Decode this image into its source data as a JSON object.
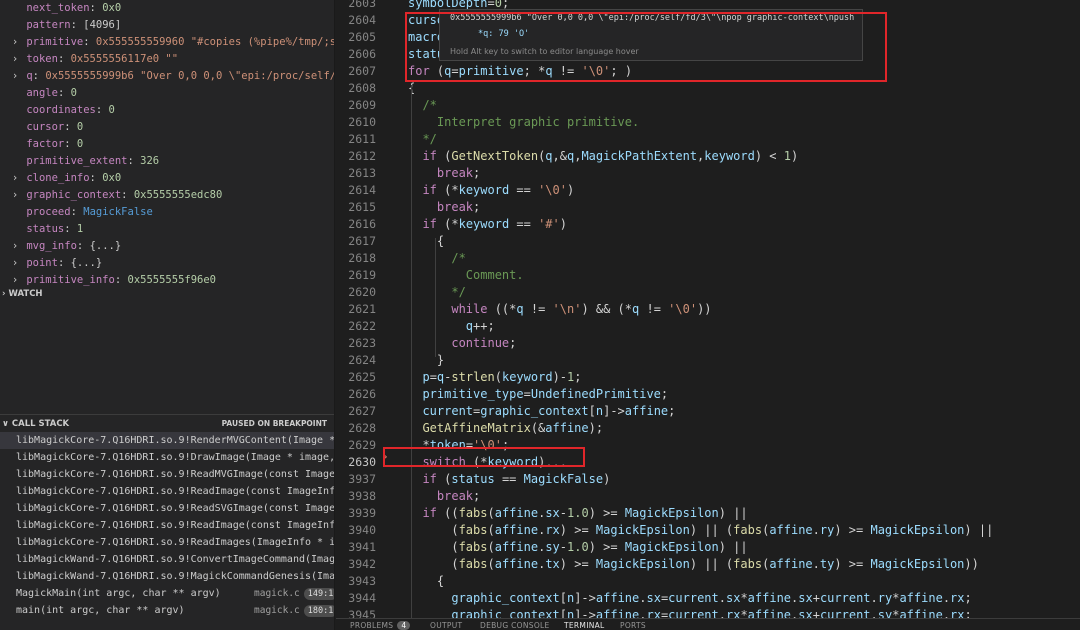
{
  "variables": [
    {
      "twisty": "",
      "name": "next_token",
      "value": "0x0",
      "vtype": "n"
    },
    {
      "twisty": "",
      "name": "pattern",
      "value": "[4096]",
      "vtype": "p"
    },
    {
      "twisty": "›",
      "name": "primitive",
      "value": "0x555555559960 \"#copies (%pipe%/tmp/;sleep 10…",
      "vtype": "v"
    },
    {
      "twisty": "›",
      "name": "token",
      "value": "0x5555556117e0 \"\"",
      "vtype": "v"
    },
    {
      "twisty": "›",
      "name": "q",
      "value": "0x5555555999b6 \"Over 0,0 0,0 \\\"epi:/proc/self/fd/3\\\"\\…",
      "vtype": "v"
    },
    {
      "twisty": "",
      "name": "angle",
      "value": "0",
      "vtype": "n"
    },
    {
      "twisty": "",
      "name": "coordinates",
      "value": "0",
      "vtype": "n"
    },
    {
      "twisty": "",
      "name": "cursor",
      "value": "0",
      "vtype": "n"
    },
    {
      "twisty": "",
      "name": "factor",
      "value": "0",
      "vtype": "n"
    },
    {
      "twisty": "",
      "name": "primitive_extent",
      "value": "326",
      "vtype": "n"
    },
    {
      "twisty": "›",
      "name": "clone_info",
      "value": "0x0",
      "vtype": "n"
    },
    {
      "twisty": "›",
      "name": "graphic_context",
      "value": "0x5555555edc80",
      "vtype": "n"
    },
    {
      "twisty": "",
      "name": "proceed",
      "value": "MagickFalse",
      "vtype": "b"
    },
    {
      "twisty": "",
      "name": "status",
      "value": "1",
      "vtype": "n"
    },
    {
      "twisty": "›",
      "name": "mvg_info",
      "value": "{...}",
      "vtype": "p"
    },
    {
      "twisty": "›",
      "name": "point",
      "value": "{...}",
      "vtype": "p"
    },
    {
      "twisty": "›",
      "name": "primitive_info",
      "value": "0x5555555f96e0",
      "vtype": "n"
    }
  ],
  "watch": {
    "label": "WATCH",
    "twisty": "›"
  },
  "callstack": {
    "label": "CALL STACK",
    "twisty": "∨",
    "status": "PAUSED ON BREAKPOINT",
    "frames": [
      {
        "name": "libMagickCore-7.Q16HDRI.so.9!RenderMVGContent(Image * image, const DrawInfo * draw_info, const size_t depth)",
        "src": "",
        "line": "",
        "active": true
      },
      {
        "name": "libMagickCore-7.Q16HDRI.so.9!DrawImage(Image * image, const DrawInfo * draw_info)",
        "src": "",
        "line": ""
      },
      {
        "name": "libMagickCore-7.Q16HDRI.so.9!ReadMVGImage(const ImageInfo * image_info)",
        "src": "",
        "line": ""
      },
      {
        "name": "libMagickCore-7.Q16HDRI.so.9!ReadImage(const ImageInfo * image_info)",
        "src": "",
        "line": ""
      },
      {
        "name": "libMagickCore-7.Q16HDRI.so.9!ReadSVGImage(const ImageInfo * image_info)",
        "src": "",
        "line": ""
      },
      {
        "name": "libMagickCore-7.Q16HDRI.so.9!ReadImage(const ImageInfo * image_info)",
        "src": "",
        "line": ""
      },
      {
        "name": "libMagickCore-7.Q16HDRI.so.9!ReadImages(ImageInfo * image_info)",
        "src": "",
        "line": ""
      },
      {
        "name": "libMagickWand-7.Q16HDRI.so.9!ConvertImageCommand(ImageInfo * image_info)",
        "src": "",
        "line": ""
      },
      {
        "name": "libMagickWand-7.Q16HDRI.so.9!MagickCommandGenesis(ImageInfo * image_info)",
        "src": "",
        "line": ""
      },
      {
        "name": "MagickMain(int argc, char ** argv)",
        "src": "magick.c",
        "line": "149:1"
      },
      {
        "name": "main(int argc, char ** argv)",
        "src": "magick.c",
        "line": "180:1"
      }
    ]
  },
  "hover": {
    "line1": "0x5555555999b6 \"Over 0,0 0,0 \\\"epi:/proc/self/fd/3\\\"\\npop graphic-context\\npush graphic-contex…",
    "line2": "*q: 79 'O'",
    "line3": "Hold Alt key to switch to editor language hover"
  },
  "code": [
    {
      "n": "2603",
      "html": "<span class=\"vr\">symbolDepth</span>=<span class=\"nm\">0</span>;"
    },
    {
      "n": "2604",
      "html": "<span class=\"vr\">curso</span>"
    },
    {
      "n": "2605",
      "html": "<span class=\"vr\">macro</span>"
    },
    {
      "n": "2606",
      "html": "<span class=\"vr\">statu</span>"
    },
    {
      "n": "2607",
      "html": "<span class=\"kw\">for</span> (<span class=\"vr\">q</span>=<span class=\"vr\">primitive</span>; *<span class=\"vr\">q</span> != <span class=\"st\">'\\0'</span>; )"
    },
    {
      "n": "2608",
      "html": "{"
    },
    {
      "n": "2609",
      "html": "  <span class=\"cm\">/*</span>"
    },
    {
      "n": "2610",
      "html": "  <span class=\"cm\">  Interpret graphic primitive.</span>"
    },
    {
      "n": "2611",
      "html": "  <span class=\"cm\">*/</span>"
    },
    {
      "n": "2612",
      "html": "  <span class=\"kw\">if</span> (<span class=\"fn\">GetNextToken</span>(<span class=\"vr\">q</span>,&amp;<span class=\"vr\">q</span>,<span class=\"vr\">MagickPathExtent</span>,<span class=\"vr\">keyword</span>) &lt; <span class=\"nm\">1</span>)"
    },
    {
      "n": "2613",
      "html": "    <span class=\"kw\">break</span>;"
    },
    {
      "n": "2614",
      "html": "  <span class=\"kw\">if</span> (*<span class=\"vr\">keyword</span> == <span class=\"st\">'\\0'</span>)"
    },
    {
      "n": "2615",
      "html": "    <span class=\"kw\">break</span>;"
    },
    {
      "n": "2616",
      "html": "  <span class=\"kw\">if</span> (*<span class=\"vr\">keyword</span> == <span class=\"st\">'#'</span>)"
    },
    {
      "n": "2617",
      "html": "    {"
    },
    {
      "n": "2618",
      "html": "      <span class=\"cm\">/*</span>"
    },
    {
      "n": "2619",
      "html": "      <span class=\"cm\">  Comment.</span>"
    },
    {
      "n": "2620",
      "html": "      <span class=\"cm\">*/</span>"
    },
    {
      "n": "2621",
      "html": "      <span class=\"kw\">while</span> ((*<span class=\"vr\">q</span> != <span class=\"st\">'\\n'</span>) &amp;&amp; (*<span class=\"vr\">q</span> != <span class=\"st\">'\\0'</span>))"
    },
    {
      "n": "2622",
      "html": "        <span class=\"vr\">q</span>++;"
    },
    {
      "n": "2623",
      "html": "      <span class=\"kw\">continue</span>;"
    },
    {
      "n": "2624",
      "html": "    }"
    },
    {
      "n": "2625",
      "html": "  <span class=\"vr\">p</span>=<span class=\"vr\">q</span>-<span class=\"fn\">strlen</span>(<span class=\"vr\">keyword</span>)-<span class=\"nm\">1</span>;"
    },
    {
      "n": "2626",
      "html": "  <span class=\"vr\">primitive_type</span>=<span class=\"vr\">UndefinedPrimitive</span>;"
    },
    {
      "n": "2627",
      "html": "  <span class=\"vr\">current</span>=<span class=\"vr\">graphic_context</span>[<span class=\"vr\">n</span>]-&gt;<span class=\"vr\">affine</span>;"
    },
    {
      "n": "2628",
      "html": "  <span class=\"fn\">GetAffineMatrix</span>(&amp;<span class=\"vr\">affine</span>);"
    },
    {
      "n": "2629",
      "html": "  *<span class=\"vr\">token</span>=<span class=\"st\">'\\0'</span>;"
    },
    {
      "n": "2630",
      "html": "  <span class=\"kw\">switch</span> (*<span class=\"vr\">keyword</span>)<span style=\"color:#6e6e6e\">...</span>",
      "cur": true
    },
    {
      "n": "3937",
      "html": "  <span class=\"kw\">if</span> (<span class=\"vr\">status</span> == <span class=\"vr\">MagickFalse</span>)"
    },
    {
      "n": "3938",
      "html": "    <span class=\"kw\">break</span>;"
    },
    {
      "n": "3939",
      "html": "  <span class=\"kw\">if</span> ((<span class=\"fn\">fabs</span>(<span class=\"vr\">affine</span>.<span class=\"vr\">sx</span>-<span class=\"nm\">1.0</span>) &gt;= <span class=\"vr\">MagickEpsilon</span>) ||"
    },
    {
      "n": "3940",
      "html": "      (<span class=\"fn\">fabs</span>(<span class=\"vr\">affine</span>.<span class=\"vr\">rx</span>) &gt;= <span class=\"vr\">MagickEpsilon</span>) || (<span class=\"fn\">fabs</span>(<span class=\"vr\">affine</span>.<span class=\"vr\">ry</span>) &gt;= <span class=\"vr\">MagickEpsilon</span>) ||"
    },
    {
      "n": "3941",
      "html": "      (<span class=\"fn\">fabs</span>(<span class=\"vr\">affine</span>.<span class=\"vr\">sy</span>-<span class=\"nm\">1.0</span>) &gt;= <span class=\"vr\">MagickEpsilon</span>) ||"
    },
    {
      "n": "3942",
      "html": "      (<span class=\"fn\">fabs</span>(<span class=\"vr\">affine</span>.<span class=\"vr\">tx</span>) &gt;= <span class=\"vr\">MagickEpsilon</span>) || (<span class=\"fn\">fabs</span>(<span class=\"vr\">affine</span>.<span class=\"vr\">ty</span>) &gt;= <span class=\"vr\">MagickEpsilon</span>))"
    },
    {
      "n": "3943",
      "html": "    {"
    },
    {
      "n": "3944",
      "html": "      <span class=\"vr\">graphic_context</span>[<span class=\"vr\">n</span>]-&gt;<span class=\"vr\">affine</span>.<span class=\"vr\">sx</span>=<span class=\"vr\">current</span>.<span class=\"vr\">sx</span>*<span class=\"vr\">affine</span>.<span class=\"vr\">sx</span>+<span class=\"vr\">current</span>.<span class=\"vr\">ry</span>*<span class=\"vr\">affine</span>.<span class=\"vr\">rx</span>;"
    },
    {
      "n": "3945",
      "html": "      <span class=\"vr\">graphic_context</span>[<span class=\"vr\">n</span>]-&gt;<span class=\"vr\">affine</span>.<span class=\"vr\">rx</span>=<span class=\"vr\">current</span>.<span class=\"vr\">rx</span>*<span class=\"vr\">affine</span>.<span class=\"vr\">sx</span>+<span class=\"vr\">current</span>.<span class=\"vr\">sy</span>*<span class=\"vr\">affine</span>.<span class=\"vr\">rx</span>;"
    }
  ],
  "panel_tabs": [
    {
      "label": "PROBLEMS",
      "badge": "4"
    },
    {
      "label": "OUTPUT"
    },
    {
      "label": "DEBUG CONSOLE"
    },
    {
      "label": "TERMINAL",
      "active": true
    },
    {
      "label": "PORTS"
    }
  ]
}
